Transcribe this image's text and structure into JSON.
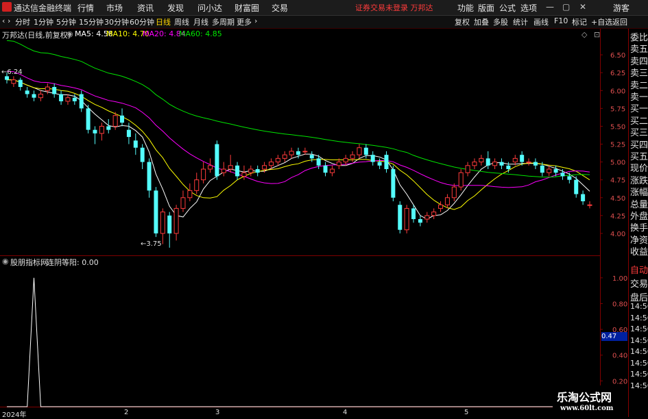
{
  "app": {
    "title": "通达信金融终端",
    "logo_letter": "R"
  },
  "menu": [
    "行情",
    "市场",
    "资讯",
    "发现",
    "问小达",
    "财富圈",
    "交易"
  ],
  "notice": "证券交易未登录  万邦达",
  "right_menu": [
    "功能",
    "版面",
    "公式",
    "选项"
  ],
  "guest": "游客",
  "period_tabs": [
    "分时",
    "1分钟",
    "5分钟",
    "15分钟",
    "30分钟",
    "60分钟",
    "日线",
    "周线",
    "月线",
    "多周期",
    "更多"
  ],
  "active_period": "日线",
  "tool_buttons": [
    "复权",
    "加叠",
    "多股",
    "统计",
    "画线",
    "F10",
    "标记",
    "+自选",
    "返回"
  ],
  "legend": {
    "stock": "万邦达(日线,前复权)",
    "ma5": "MA5: 4.58",
    "ma10": "MA10: 4.70",
    "ma20": "MA20: 4.84",
    "ma60": "MA60: 4.85"
  },
  "colors": {
    "up": "#ff3b3b",
    "down": "#54fcfc",
    "ma5": "#ffffff",
    "ma10": "#ffff00",
    "ma20": "#ff00ff",
    "ma60": "#00e600",
    "grid": "#800000"
  },
  "price_axis": [
    "6.50",
    "6.25",
    "6.00",
    "5.75",
    "5.50",
    "5.25",
    "5.00",
    "4.75",
    "4.50",
    "4.25",
    "4.00"
  ],
  "high_mark": "6.24",
  "low_mark": "3.75",
  "indicator": {
    "name": "股朋指标网",
    "series": "连阴等阳: 0.00",
    "current": "0.47"
  },
  "indicator_axis": [
    "1.00",
    "0.80",
    "0.60",
    "0.40",
    "0.20"
  ],
  "x_labels": [
    "2024年",
    "2",
    "3",
    "4",
    "5"
  ],
  "side_labels": [
    "委比",
    "卖五",
    "卖四",
    "卖三",
    "卖二",
    "卖一",
    "买一",
    "买二",
    "买三",
    "买四",
    "买五",
    "现价",
    "涨跌",
    "涨幅",
    "总量",
    "外盘",
    "换手",
    "净资",
    "收益"
  ],
  "side_lower": [
    "自动",
    "交易",
    "盘后"
  ],
  "side_times": [
    "14:56",
    "14:56",
    "14:56",
    "14:56",
    "14:56",
    "14:56",
    "14:56",
    "14:56"
  ],
  "watermark": {
    "cn": "乐淘公式网",
    "url": "www.60lt.com"
  },
  "chart_data": {
    "type": "candlestick",
    "price_range": [
      3.75,
      6.75
    ],
    "candles": [
      [
        6.2,
        6.15,
        6.25,
        6.1
      ],
      [
        6.1,
        6.15,
        6.2,
        6.05
      ],
      [
        6.15,
        6.05,
        6.18,
        6.0
      ],
      [
        6.0,
        5.95,
        6.05,
        5.9
      ],
      [
        5.95,
        5.9,
        6.0,
        5.85
      ],
      [
        5.9,
        5.95,
        6.0,
        5.85
      ],
      [
        6.0,
        6.05,
        6.1,
        5.95
      ],
      [
        6.05,
        5.95,
        6.1,
        5.9
      ],
      [
        5.95,
        5.85,
        6.0,
        5.8
      ],
      [
        5.85,
        5.9,
        5.95,
        5.8
      ],
      [
        5.9,
        5.85,
        5.95,
        5.8
      ],
      [
        5.95,
        5.75,
        6.0,
        5.7
      ],
      [
        5.75,
        5.45,
        5.8,
        5.4
      ],
      [
        5.45,
        5.4,
        5.5,
        5.25
      ],
      [
        5.4,
        5.5,
        5.55,
        5.3
      ],
      [
        5.5,
        5.45,
        5.6,
        5.4
      ],
      [
        5.5,
        5.65,
        5.7,
        5.45
      ],
      [
        5.65,
        5.55,
        5.75,
        5.5
      ],
      [
        5.45,
        5.35,
        5.55,
        5.25
      ],
      [
        5.3,
        5.2,
        5.4,
        5.1
      ],
      [
        5.2,
        5.0,
        5.25,
        4.9
      ],
      [
        5.0,
        4.6,
        5.05,
        4.5
      ],
      [
        4.6,
        4.0,
        4.65,
        3.95
      ],
      [
        4.0,
        4.3,
        4.35,
        3.85
      ],
      [
        4.25,
        4.0,
        4.3,
        3.8
      ],
      [
        4.0,
        4.35,
        4.4,
        3.9
      ],
      [
        4.35,
        4.5,
        4.6,
        4.3
      ],
      [
        4.5,
        4.6,
        4.7,
        4.45
      ],
      [
        4.6,
        4.75,
        4.85,
        4.55
      ],
      [
        4.75,
        4.9,
        5.0,
        4.7
      ],
      [
        4.9,
        4.95,
        5.05,
        4.85
      ],
      [
        5.25,
        4.8,
        5.3,
        4.75
      ],
      [
        4.85,
        4.9,
        5.0,
        4.8
      ],
      [
        4.9,
        4.95,
        5.1,
        4.85
      ],
      [
        4.95,
        4.8,
        5.0,
        4.75
      ],
      [
        4.8,
        4.85,
        4.95,
        4.75
      ],
      [
        4.85,
        4.9,
        4.95,
        4.8
      ],
      [
        4.9,
        4.85,
        4.95,
        4.8
      ],
      [
        4.9,
        4.95,
        5.0,
        4.85
      ],
      [
        4.95,
        5.0,
        5.05,
        4.9
      ],
      [
        5.0,
        5.05,
        5.1,
        4.95
      ],
      [
        5.05,
        5.1,
        5.15,
        5.0
      ],
      [
        5.1,
        5.15,
        5.2,
        5.05
      ],
      [
        5.15,
        5.1,
        5.2,
        5.05
      ],
      [
        5.15,
        5.15,
        5.2,
        5.1
      ],
      [
        5.1,
        5.05,
        5.15,
        5.0
      ],
      [
        5.05,
        4.95,
        5.1,
        4.9
      ],
      [
        4.95,
        4.85,
        5.0,
        4.8
      ],
      [
        4.85,
        4.9,
        4.95,
        4.8
      ],
      [
        4.95,
        5.0,
        5.05,
        4.9
      ],
      [
        5.0,
        5.05,
        5.1,
        4.95
      ],
      [
        5.05,
        5.1,
        5.15,
        5.0
      ],
      [
        5.1,
        5.2,
        5.25,
        5.05
      ],
      [
        5.2,
        5.1,
        5.25,
        5.05
      ],
      [
        5.1,
        5.0,
        5.15,
        4.95
      ],
      [
        5.0,
        4.95,
        5.05,
        4.9
      ],
      [
        5.1,
        4.9,
        5.15,
        4.85
      ],
      [
        4.9,
        4.5,
        4.95,
        4.45
      ],
      [
        4.4,
        4.05,
        4.45,
        4.0
      ],
      [
        4.05,
        4.35,
        4.4,
        4.0
      ],
      [
        4.35,
        4.2,
        4.4,
        4.15
      ],
      [
        4.2,
        4.15,
        4.25,
        4.1
      ],
      [
        4.2,
        4.25,
        4.3,
        4.15
      ],
      [
        4.25,
        4.3,
        4.35,
        4.2
      ],
      [
        4.35,
        4.4,
        4.45,
        4.3
      ],
      [
        4.4,
        4.5,
        4.55,
        4.35
      ],
      [
        4.5,
        4.65,
        4.7,
        4.45
      ],
      [
        4.65,
        4.85,
        4.9,
        4.6
      ],
      [
        4.85,
        4.95,
        5.0,
        4.8
      ],
      [
        4.95,
        5.0,
        5.05,
        4.9
      ],
      [
        5.0,
        5.05,
        5.1,
        4.95
      ],
      [
        5.05,
        4.95,
        5.15,
        4.9
      ],
      [
        4.95,
        5.0,
        5.05,
        4.9
      ],
      [
        5.0,
        4.95,
        5.05,
        4.9
      ],
      [
        4.95,
        4.9,
        5.0,
        4.85
      ],
      [
        5.0,
        5.05,
        5.1,
        4.95
      ],
      [
        5.1,
        5.0,
        5.15,
        4.95
      ],
      [
        5.0,
        5.0,
        5.05,
        4.95
      ],
      [
        5.0,
        4.95,
        5.05,
        4.9
      ],
      [
        4.95,
        4.85,
        5.0,
        4.8
      ],
      [
        4.85,
        4.9,
        4.95,
        4.8
      ],
      [
        4.9,
        4.85,
        4.95,
        4.8
      ],
      [
        4.85,
        4.8,
        4.9,
        4.75
      ],
      [
        4.8,
        4.75,
        4.85,
        4.7
      ],
      [
        4.75,
        4.55,
        4.8,
        4.5
      ],
      [
        4.55,
        4.45,
        4.6,
        4.4
      ],
      [
        4.4,
        4.4,
        4.45,
        4.35
      ]
    ],
    "indicator_range": [
      0,
      1.1
    ],
    "indicator_values": {
      "spike_index": 4,
      "spike_value": 1.0
    }
  }
}
